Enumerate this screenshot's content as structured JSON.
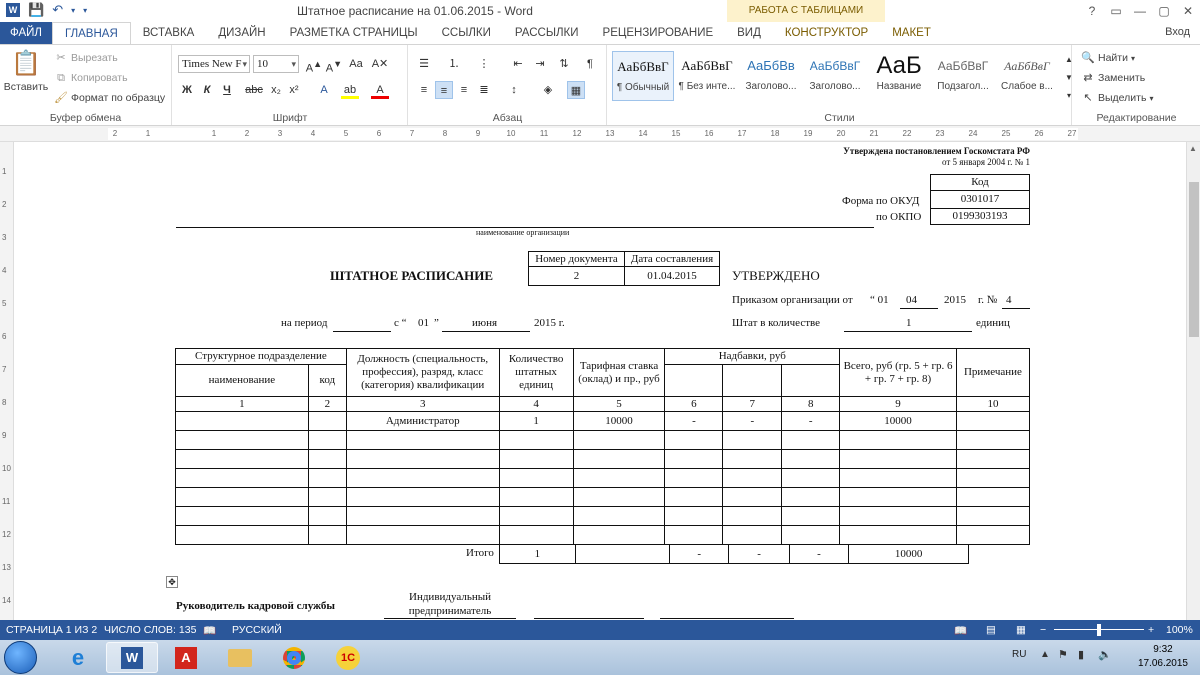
{
  "window": {
    "title": "Штатное расписание на 01.06.2015 - Word",
    "context_band": "РАБОТА С ТАБЛИЦАМИ",
    "help": "?",
    "controls": [
      "▭",
      "—",
      "▢",
      "✕"
    ]
  },
  "tabs": [
    "ФАЙЛ",
    "ГЛАВНАЯ",
    "ВСТАВКА",
    "ДИЗАЙН",
    "РАЗМЕТКА СТРАНИЦЫ",
    "ССЫЛКИ",
    "РАССЫЛКИ",
    "РЕЦЕНЗИРОВАНИЕ",
    "ВИД",
    "КОНСТРУКТОР",
    "МАКЕТ"
  ],
  "signin": "Вход",
  "ribbon": {
    "clipboard": {
      "paste": "Вставить",
      "cut": "Вырезать",
      "copy": "Копировать",
      "format": "Формат по образцу",
      "label": "Буфер обмена"
    },
    "font": {
      "name": "Times New F",
      "size": "10",
      "label": "Шрифт"
    },
    "paragraph": {
      "label": "Абзац"
    },
    "styles": {
      "label": "Стили",
      "items": [
        {
          "preview": "АаБбВвГ",
          "name": "¶ Обычный"
        },
        {
          "preview": "АаБбВвГ",
          "name": "¶ Без инте..."
        },
        {
          "preview": "АаБбВв",
          "name": "Заголово..."
        },
        {
          "preview": "АаБбВвГ",
          "name": "Заголово..."
        },
        {
          "preview": "АаБ",
          "name": "Название"
        },
        {
          "preview": "АаБбВвГ",
          "name": "Подзагол..."
        },
        {
          "preview": "АаБбВвГ",
          "name": "Слабое в..."
        }
      ]
    },
    "editing": {
      "find": "Найти",
      "replace": "Заменить",
      "select": "Выделить",
      "label": "Редактирование"
    }
  },
  "document": {
    "approved_note_1": "Утверждена постановлением Госкомстата РФ",
    "approved_note_2": "от 5 января 2004 г. № 1",
    "code_header": "Код",
    "okud_label": "Форма по ОКУД",
    "okud_value": "0301017",
    "okpo_label": "по ОКПО",
    "okpo_value": "0199303193",
    "org_caption": "наименование организации",
    "doc_number_header": "Номер документа",
    "doc_date_header": "Дата составления",
    "doc_number": "2",
    "doc_date": "01.04.2015",
    "title": "ШТАТНОЕ РАСПИСАНИЕ",
    "approved": "УТВЕРЖДЕНО",
    "order_text": "Приказом организации от",
    "order_day": "“ 01",
    "order_month": "04",
    "order_year": "2015",
    "order_year_suffix": "г. №",
    "order_number": "4",
    "period_label": "на период",
    "period_from": "с “",
    "period_day": "01",
    "period_quote": "”",
    "period_month": "июня",
    "period_year": "2015  г.",
    "staff_label": "Штат в количестве",
    "staff_count": "1",
    "staff_unit": "единиц",
    "table": {
      "h_division": "Структурное подразделение",
      "h_name": "наименование",
      "h_code": "код",
      "h_position": "Должность (специальность, профессия), разряд, класс (категория) квалификации",
      "h_count": "Количество штатных единиц",
      "h_rate": "Тарифная ставка (оклад) и пр., руб",
      "h_bonus": "Надбавки, руб",
      "h_total": "Всего, руб (гр. 5 + гр. 6 + гр. 7 + гр. 8)",
      "h_note": "Примечание",
      "numbers": [
        "1",
        "2",
        "3",
        "4",
        "5",
        "6",
        "7",
        "8",
        "9",
        "10"
      ],
      "rows": [
        [
          "",
          "",
          "Администратор",
          "1",
          "10000",
          "-",
          "-",
          "-",
          "10000",
          ""
        ]
      ],
      "total_label": "Итого",
      "total_row": [
        "1",
        "",
        "-",
        "-",
        "-",
        "10000",
        ""
      ]
    },
    "head_label": "Руководитель кадровой службы",
    "head_position": "Индивидуальный предприниматель"
  },
  "status": {
    "page": "СТРАНИЦА 1 ИЗ 2",
    "words": "ЧИСЛО СЛОВ: 135",
    "lang": "РУССКИЙ",
    "zoom": "100%"
  },
  "taskbar": {
    "lang": "RU",
    "time": "9:32",
    "date": "17.06.2015"
  }
}
